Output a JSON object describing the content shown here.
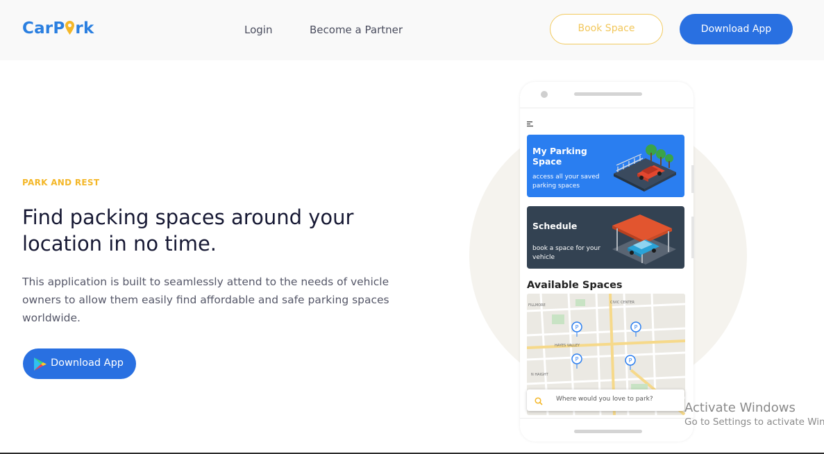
{
  "nav": {
    "logo_left": "CarP",
    "logo_right": "rk",
    "links": [
      "Login",
      "Become a Partner"
    ],
    "book_label": "Book Space",
    "download_label": "Download App"
  },
  "hero": {
    "eyebrow": "PARK AND REST",
    "headline": "Find packing spaces around your location in no time.",
    "description": "This application is built to seamlessly attend to the needs of vehicle owners to allow them easily find affordable and safe parking spaces worldwide.",
    "download_label": "Download App"
  },
  "phone": {
    "card1": {
      "title": "My Parking Space",
      "subtitle": "access all your saved parking spaces"
    },
    "card2": {
      "title": "Schedule",
      "subtitle": "book a space for your vehicle"
    },
    "available_title": "Available Spaces",
    "search_placeholder": "Where would you love to park?",
    "map_labels": [
      "CIVIC CENTER",
      "HAYES VALLEY",
      "FILLMORE",
      "N HAIGHT"
    ]
  },
  "watermark": {
    "line1": "Activate Windows",
    "line2": "Go to Settings to activate Windows."
  },
  "colors": {
    "primary": "#2970e1",
    "accent": "#f4b728",
    "card1": "#2a7ef0",
    "card2": "#334252"
  }
}
